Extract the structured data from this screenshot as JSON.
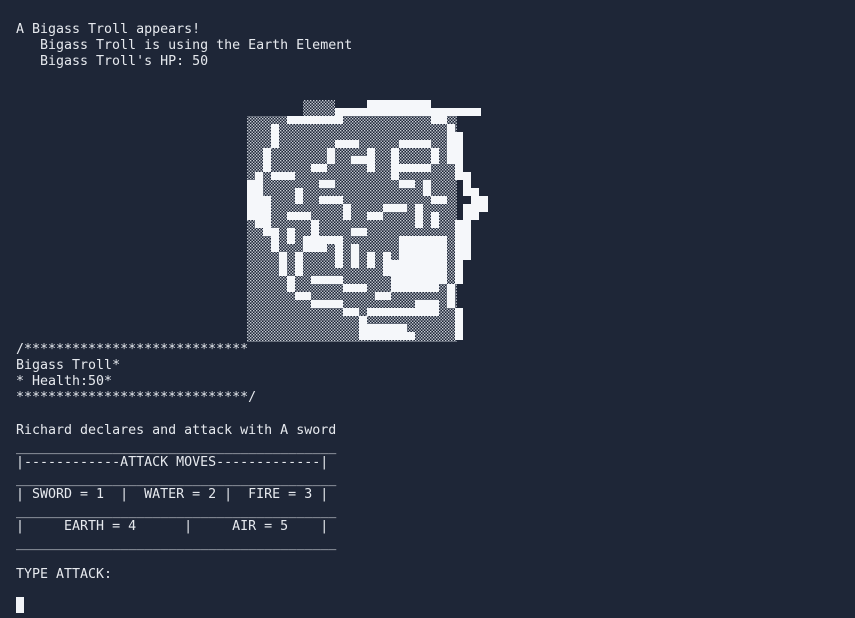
{
  "header": {
    "appears": "A Bigass Troll appears!",
    "element": "Bigass Troll is using the Earth Element",
    "hp": "Bigass Troll's HP: 50"
  },
  "status_box": {
    "top": "/****************************",
    "name": "Bigass Troll*",
    "health": "* Health:50*",
    "bottom": "*****************************/"
  },
  "battle_log": "Richard declares and attack with A sword",
  "attack_menu": {
    "rule1": "________________________________________",
    "title_row": "|------------ATTACK MOVES-------------|",
    "rule2": "________________________________________",
    "row1": "| SWORD = 1  |  WATER = 2 |  FIRE = 3 |",
    "rule3": "________________________________________",
    "row2": "|     EARTH = 4      |     AIR = 5    |",
    "rule4": "________________________________________"
  },
  "prompt": "TYPE ATTACK:",
  "art": {
    "name": "troll-face-ascii-art",
    "colors": {
      "solid": "#f5f7fa",
      "shade": "#c9ced6"
    }
  }
}
